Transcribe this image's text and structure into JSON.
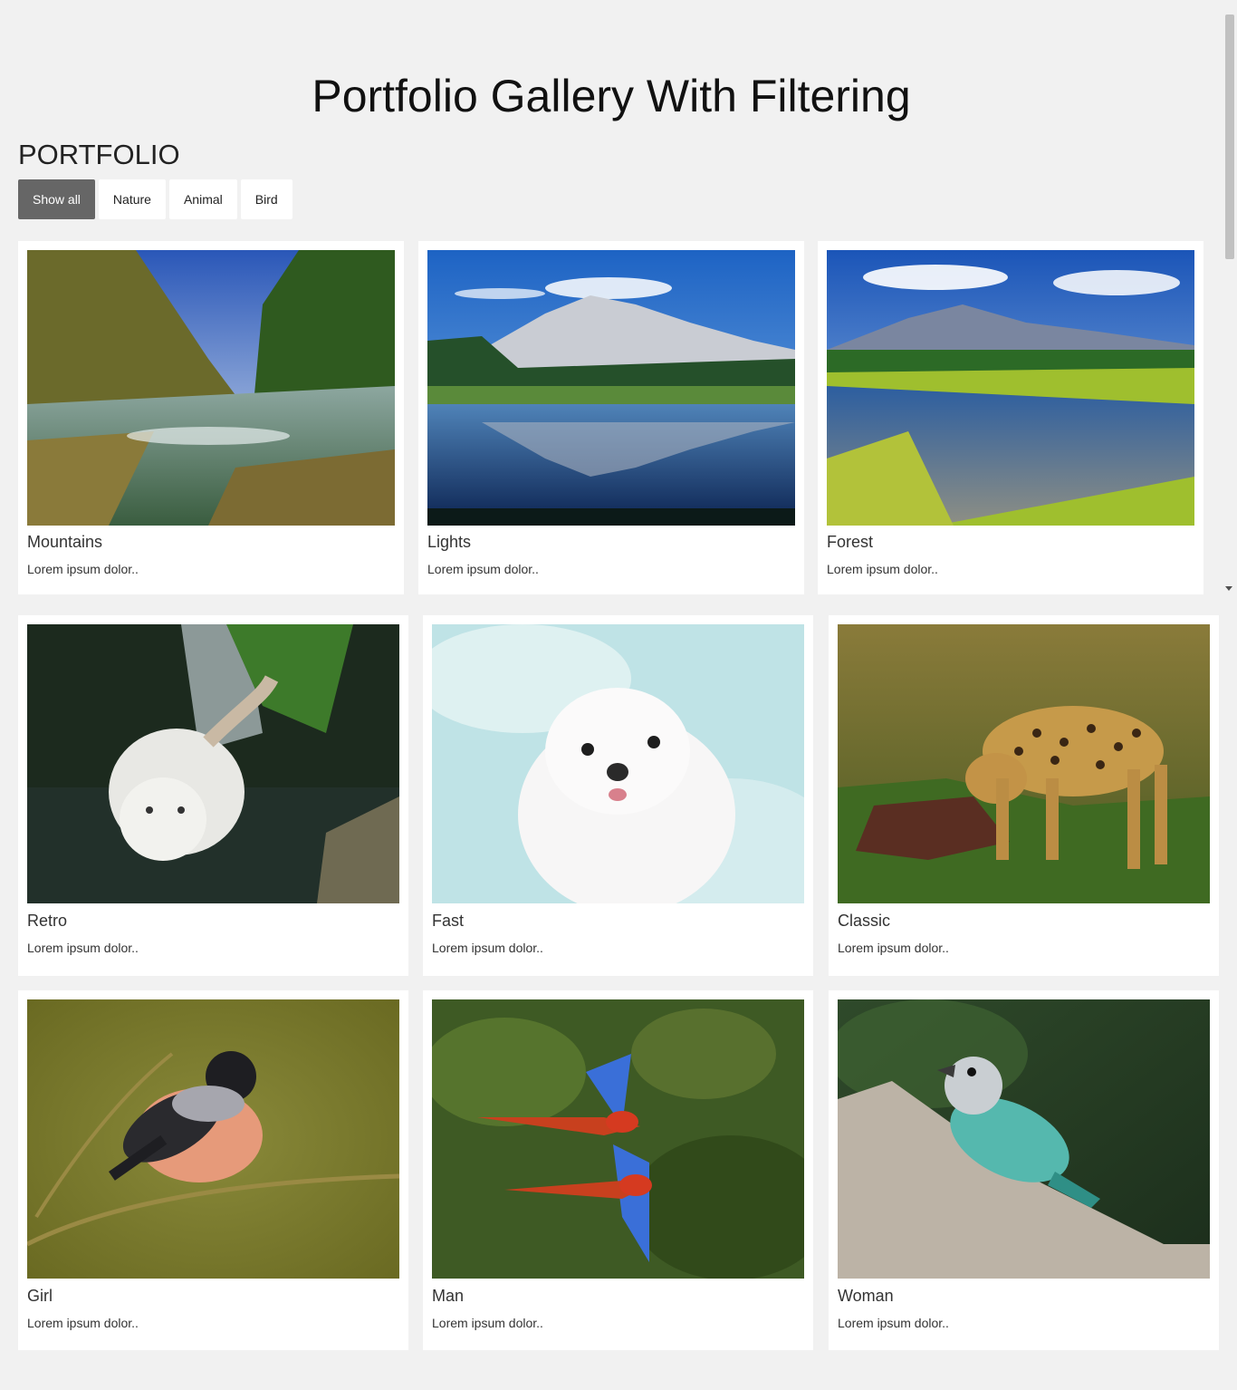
{
  "page": {
    "title": "Portfolio Gallery With Filtering",
    "section_title": "PORTFOLIO"
  },
  "filters": [
    {
      "label": "Show all",
      "active": true
    },
    {
      "label": "Nature",
      "active": false
    },
    {
      "label": "Animal",
      "active": false
    },
    {
      "label": "Bird",
      "active": false
    }
  ],
  "gallery": {
    "items": [
      {
        "title": "Mountains",
        "text": "Lorem ipsum dolor..",
        "image": "river-forest-photo",
        "category": "nature"
      },
      {
        "title": "Lights",
        "text": "Lorem ipsum dolor..",
        "image": "mountain-lake-reflection-photo",
        "category": "nature"
      },
      {
        "title": "Forest",
        "text": "Lorem ipsum dolor..",
        "image": "mountain-meadow-stream-photo",
        "category": "nature"
      },
      {
        "title": "Retro",
        "text": "Lorem ipsum dolor..",
        "image": "white-tiger-photo",
        "category": "animal"
      },
      {
        "title": "Fast",
        "text": "Lorem ipsum dolor..",
        "image": "white-puppy-photo",
        "category": "animal"
      },
      {
        "title": "Classic",
        "text": "Lorem ipsum dolor..",
        "image": "leopard-photo",
        "category": "animal"
      },
      {
        "title": "Girl",
        "text": "Lorem ipsum dolor..",
        "image": "bullfinch-photo",
        "category": "bird"
      },
      {
        "title": "Man",
        "text": "Lorem ipsum dolor..",
        "image": "macaws-flying-photo",
        "category": "bird"
      },
      {
        "title": "Woman",
        "text": "Lorem ipsum dolor..",
        "image": "tanager-bird-photo",
        "category": "bird"
      }
    ]
  },
  "colors": {
    "background": "#f1f1f1",
    "card": "#ffffff",
    "active_button": "#666666"
  }
}
